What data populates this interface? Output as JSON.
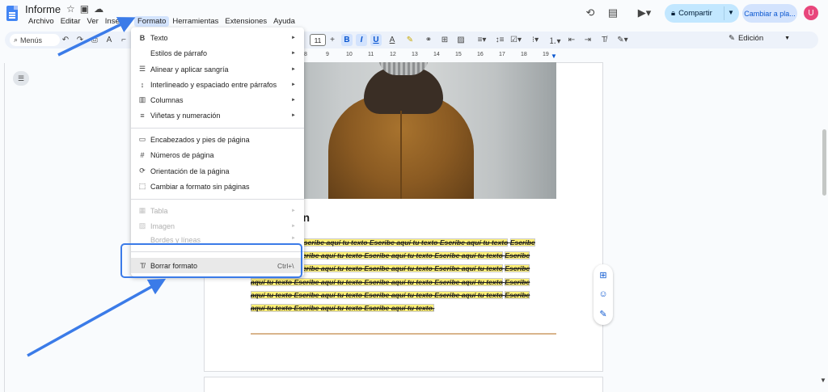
{
  "doc": {
    "title": "Informe"
  },
  "menubar": [
    "Archivo",
    "Editar",
    "Ver",
    "Insertar",
    "Formato",
    "Herramientas",
    "Extensiones",
    "Ayuda"
  ],
  "header": {
    "share_label": "Compartir",
    "switch_label": "Cambiar a pla...",
    "avatar_letter": "U"
  },
  "toolbar": {
    "search_label": "Menús",
    "font_size": "11",
    "edit_mode": "Edición",
    "bold": "B",
    "italic": "I",
    "underline": "U"
  },
  "ruler": [
    "8",
    "9",
    "10",
    "11",
    "12",
    "13",
    "14",
    "15",
    "16",
    "17",
    "18",
    "19"
  ],
  "menu": {
    "items": [
      {
        "icon": "B",
        "label": "Texto",
        "arrow": "►"
      },
      {
        "icon": "",
        "label": "Estilos de párrafo",
        "arrow": "►"
      },
      {
        "icon": "☰",
        "label": "Alinear y aplicar sangría",
        "arrow": "►"
      },
      {
        "icon": "↕",
        "label": "Interlineado y espaciado entre párrafos",
        "arrow": "►"
      },
      {
        "icon": "▥",
        "label": "Columnas",
        "arrow": "►"
      },
      {
        "icon": "≡",
        "label": "Viñetas y numeración",
        "arrow": "►"
      },
      {
        "icon": "▭",
        "label": "Encabezados y pies de página",
        "arrow": ""
      },
      {
        "icon": "#",
        "label": "Números de página",
        "arrow": ""
      },
      {
        "icon": "⟳",
        "label": "Orientación de la página",
        "arrow": ""
      },
      {
        "icon": "⬚",
        "label": "Cambiar a formato sin páginas",
        "arrow": ""
      },
      {
        "icon": "▦",
        "label": "Tabla",
        "arrow": "►"
      },
      {
        "icon": "▨",
        "label": "Imagen",
        "arrow": "►"
      },
      {
        "icon": "",
        "label": "Bordes y líneas",
        "arrow": "►"
      },
      {
        "icon": "T̸",
        "label": "Borrar formato",
        "shortcut": "Ctrl+\\"
      }
    ]
  },
  "page": {
    "heading": "ón",
    "body_lines": [
      "Escribe aquí tu texto Escribe aquí tu texto Escribe aquí tu texto",
      "Escribe aquí tu texto Escribe aquí tu texto Escribe aquí tu texto Escribe aquí tu texto",
      "Escribe aquí tu texto Escribe aquí tu texto Escribe aquí tu texto Escribe aquí tu texto",
      "Escribe aquí tu texto Escribe aquí tu texto Escribe aquí tu texto Escribe aquí tu texto",
      "Escribe aquí tu texto Escribe aquí tu texto Escribe aquí tu texto Escribe aquí tu texto",
      "Escribe aquí tu texto Escribe aquí tu texto Escribe aquí tu texto."
    ]
  },
  "colors": {
    "accent": "#3b7be8",
    "highlight": "#fff176",
    "share_bg": "#c2e7ff"
  }
}
